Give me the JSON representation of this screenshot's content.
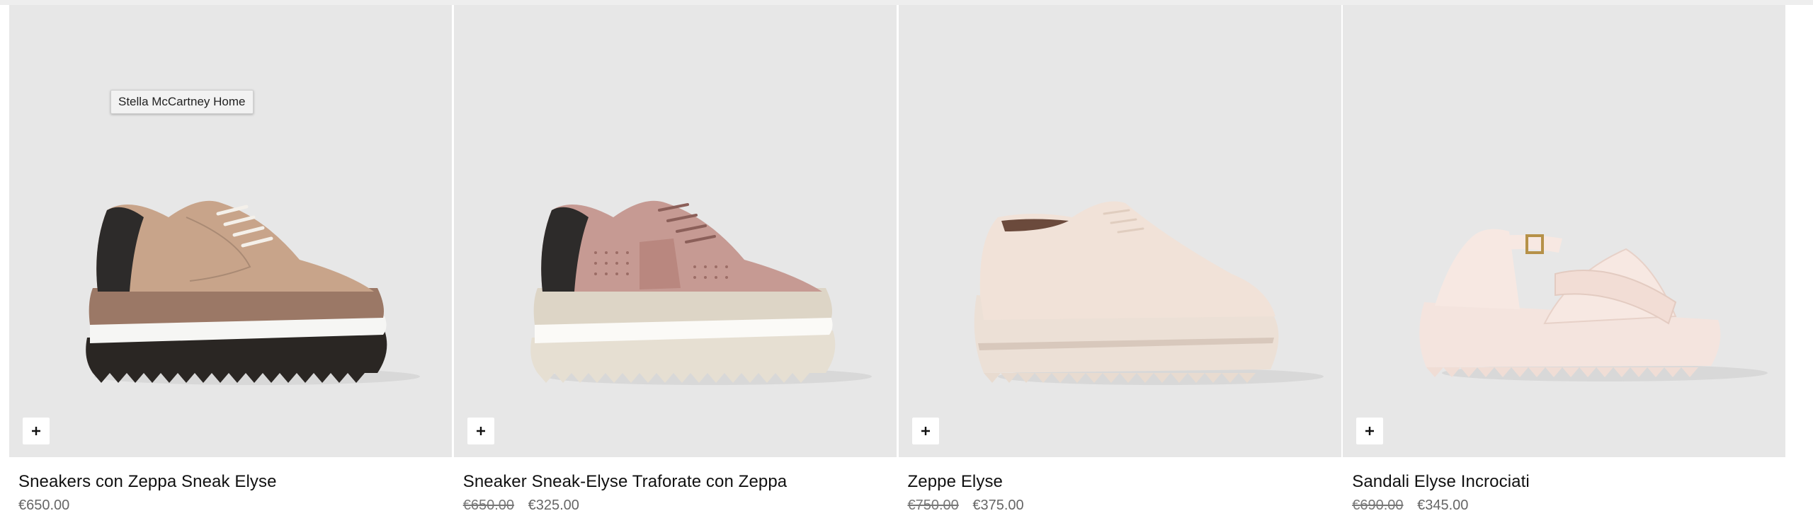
{
  "tooltip": "Stella McCartney Home",
  "quick_add_label": "+",
  "products": [
    {
      "name": "Sneakers con Zeppa Sneak Elyse",
      "price_old": "",
      "price": "€650.00"
    },
    {
      "name": "Sneaker Sneak-Elyse Traforate con Zeppa",
      "price_old": "€650.00",
      "price": "€325.00"
    },
    {
      "name": "Zeppe Elyse",
      "price_old": "€750.00",
      "price": "€375.00"
    },
    {
      "name": "Sandali Elyse Incrociati",
      "price_old": "€690.00",
      "price": "€345.00"
    }
  ],
  "colors": {
    "image_bg": "#e7e7e7",
    "text": "#111111",
    "muted": "#666666"
  },
  "icons": [
    "plus-icon"
  ]
}
